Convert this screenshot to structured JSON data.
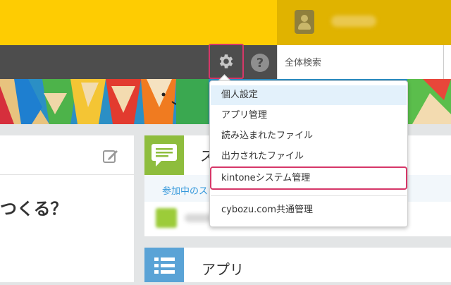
{
  "colors": {
    "topbar": "#fecc02",
    "header": "#4d4d4d",
    "highlight_border": "#d63768",
    "menu_hover": "#e3f1fb",
    "space_accent": "#8ebd3d",
    "app_accent": "#5aa3d6",
    "link": "#3498db"
  },
  "header": {
    "settings_icon": "gear-icon",
    "help_icon": "question-icon",
    "help_glyph": "?",
    "search": {
      "placeholder": "全体検索",
      "value": ""
    }
  },
  "settings_menu": {
    "items": [
      {
        "label": "個人設定",
        "highlighted": true
      },
      {
        "label": "アプリ管理"
      },
      {
        "label": "読み込まれたファイル"
      },
      {
        "label": "出力されたファイル"
      },
      {
        "label": "kintoneシステム管理",
        "outlined": true
      },
      {
        "label": "cybozu.com共通管理"
      }
    ]
  },
  "left_panel": {
    "heading": "つくる？",
    "edit_icon": "pencil-edit-icon"
  },
  "space_card": {
    "title": "ス",
    "tab": "参加中のス",
    "icon": "speech-bubble-icon"
  },
  "app_card": {
    "title": "アプリ",
    "icon": "list-icon"
  }
}
